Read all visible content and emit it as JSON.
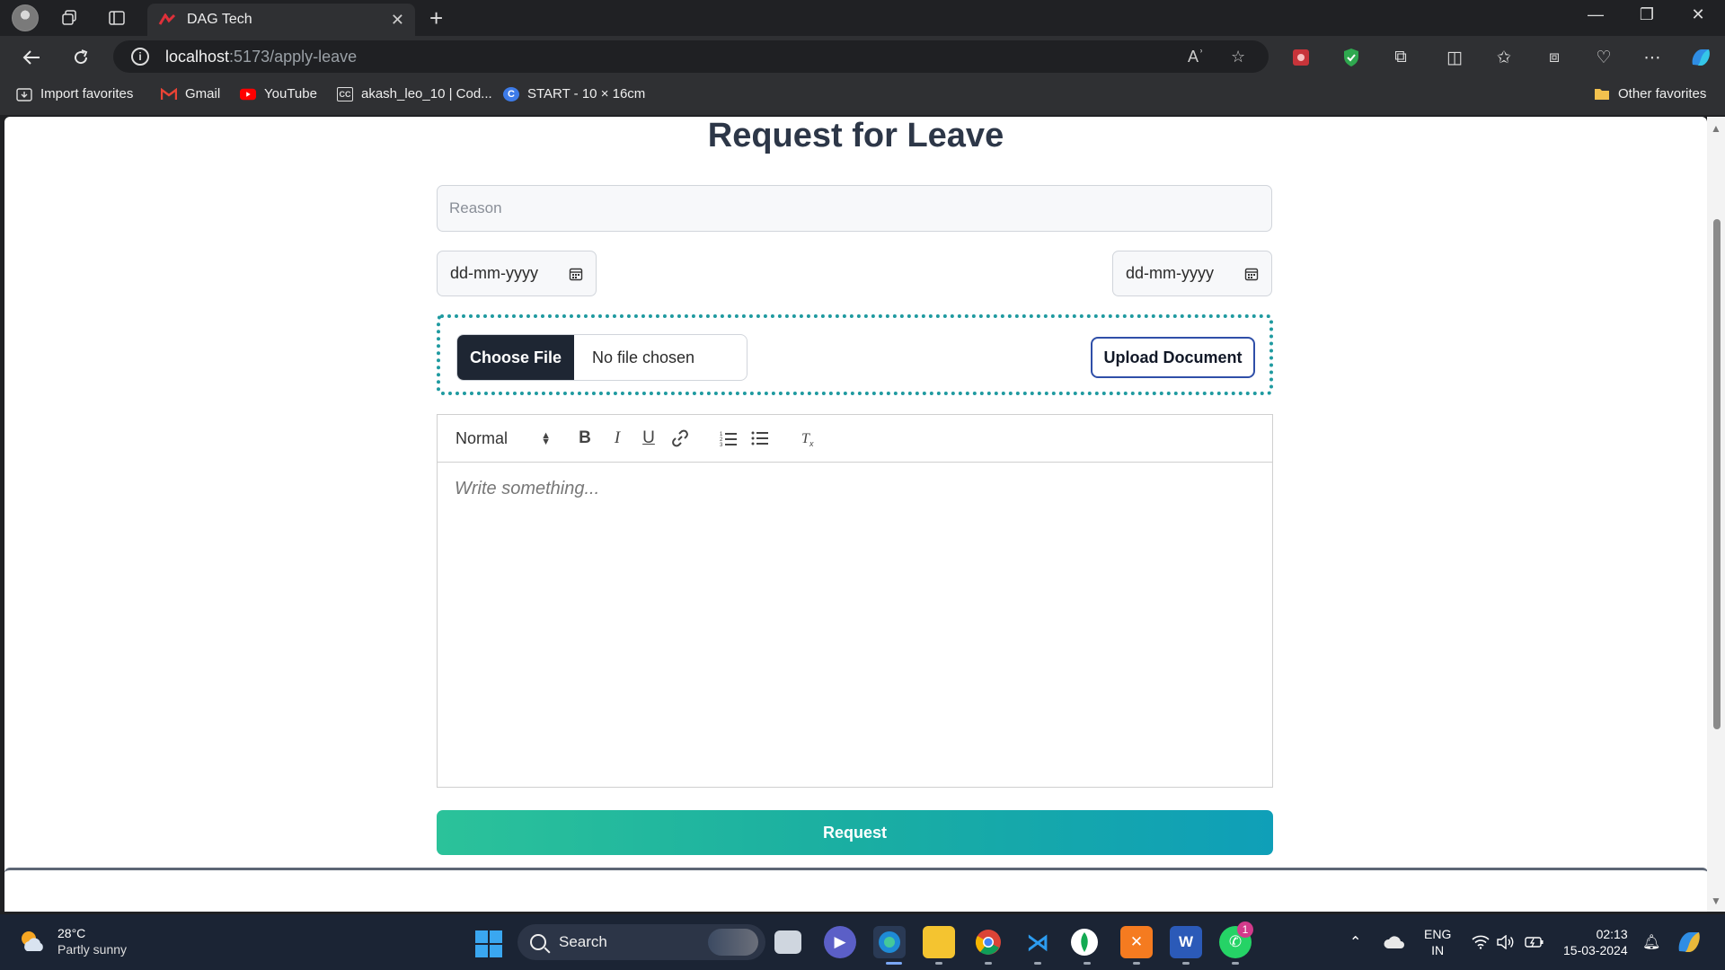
{
  "browser": {
    "tab_title": "DAG Tech",
    "tab_close": "✕",
    "new_tab": "+",
    "window_controls": [
      "—",
      "❐",
      "✕"
    ],
    "url_host": "localhost",
    "url_path": ":5173/apply-leave",
    "read_aloud": "Aʾ",
    "bookmarks": [
      {
        "label": "Import favorites",
        "icon": "import-icon"
      },
      {
        "label": "Gmail",
        "icon": "gmail-icon"
      },
      {
        "label": "YouTube",
        "icon": "youtube-icon"
      },
      {
        "label": "akash_leo_10 | Cod...",
        "icon": "codechef-icon"
      },
      {
        "label": "START - 10 × 16cm",
        "icon": "canva-icon"
      }
    ],
    "other_favorites": "Other favorites"
  },
  "form": {
    "title": "Request for Leave",
    "reason_placeholder": "Reason",
    "start_date_placeholder": "dd-mm-yyyy",
    "end_date_placeholder": "dd-mm-yyyy",
    "choose_file_label": "Choose File",
    "no_file_label": "No file chosen",
    "upload_label": "Upload Document",
    "editor": {
      "format_value": "Normal",
      "placeholder": "Write something..."
    },
    "submit_label": "Request"
  },
  "taskbar": {
    "temperature": "28°C",
    "weather": "Partly sunny",
    "search_label": "Search",
    "language": "ENG",
    "region": "IN",
    "time": "02:13",
    "date": "15-03-2024",
    "whatsapp_badge": "1"
  },
  "colors": {
    "accent_teal": "#1f9aa0",
    "button_dark": "#1e2633",
    "request_gradient_start": "#2bc29a",
    "request_gradient_end": "#0f9fb8",
    "upload_border": "#2f4fa8"
  }
}
